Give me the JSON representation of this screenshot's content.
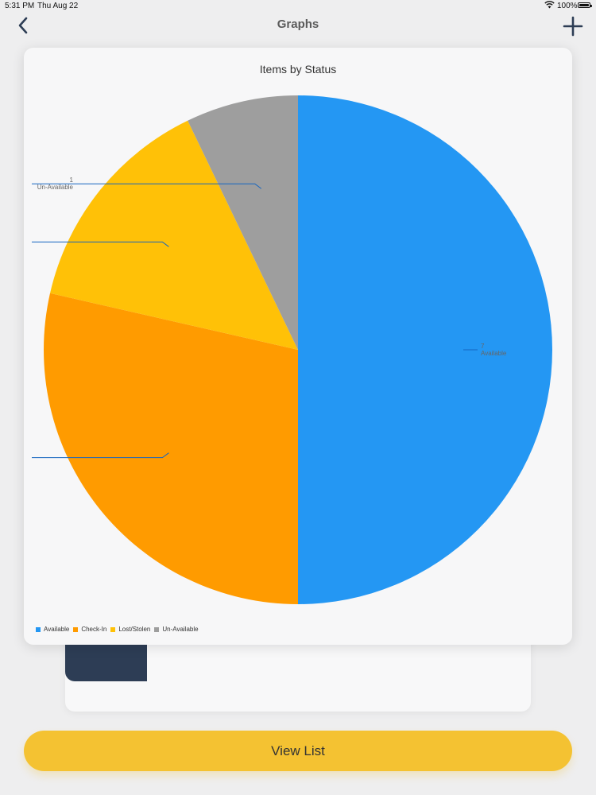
{
  "status_bar": {
    "time": "5:31 PM",
    "date": "Thu Aug 22",
    "battery": "100%"
  },
  "nav": {
    "title": "Graphs",
    "back_icon": "chevron-left-icon",
    "add_icon": "plus-icon"
  },
  "chart_card": {
    "title": "Items by Status"
  },
  "chart_data": {
    "type": "pie",
    "title": "Items by Status",
    "slices": [
      {
        "name": "Available",
        "value": 7,
        "color": "#2497f3",
        "label": "7",
        "sublabel": "Available"
      },
      {
        "name": "Check-In",
        "value": 4,
        "color": "#ff9b00",
        "label": "",
        "sublabel": ""
      },
      {
        "name": "Lost/Stolen",
        "value": 2,
        "color": "#ffc107",
        "label": "",
        "sublabel": ""
      },
      {
        "name": "Un-Available",
        "value": 1,
        "color": "#9e9e9e",
        "label": "1",
        "sublabel": "Un-Available"
      }
    ],
    "legend": [
      "Available",
      "Check-In",
      "Lost/Stolen",
      "Un-Available"
    ],
    "legend_placement": "bottom-left"
  },
  "footer": {
    "view_list_label": "View List"
  },
  "colors": {
    "accent": "#f4c232",
    "dark_block": "#2d3d55"
  }
}
